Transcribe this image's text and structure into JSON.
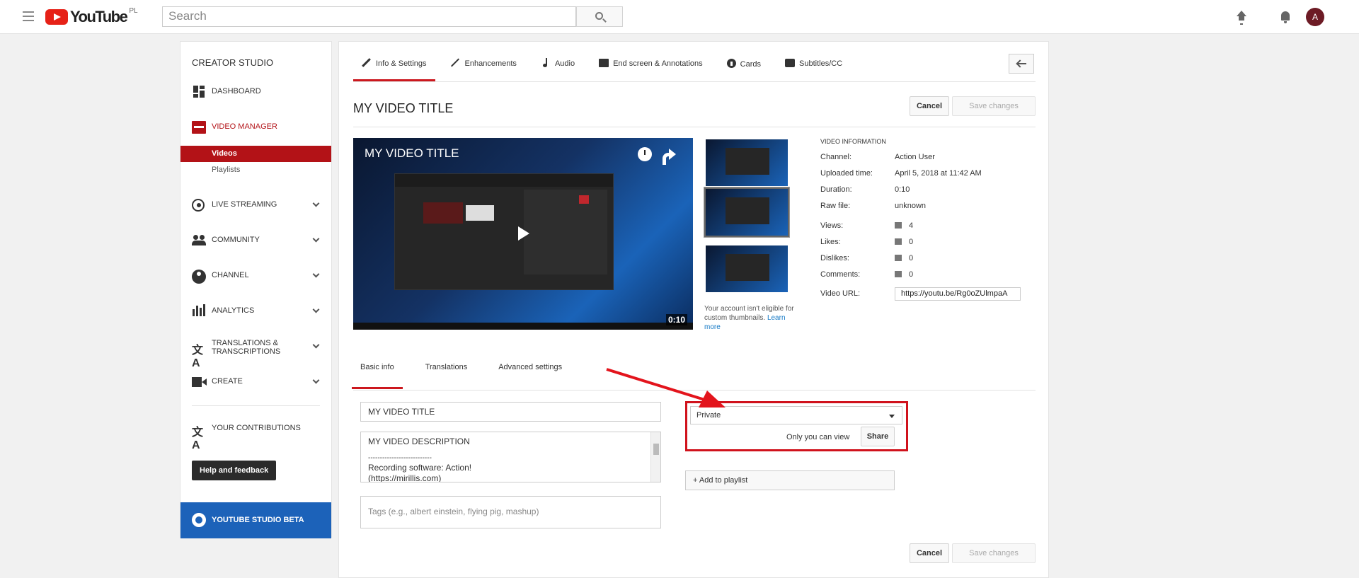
{
  "topbar": {
    "logo_text": "YouTube",
    "country": "PL",
    "search_placeholder": "Search",
    "avatar_initial": "A"
  },
  "sidebar": {
    "title": "CREATOR STUDIO",
    "items": [
      {
        "label": "DASHBOARD",
        "icon": "dashboard-icon"
      },
      {
        "label": "VIDEO MANAGER",
        "icon": "video-manager-icon",
        "active": true
      },
      {
        "label": "LIVE STREAMING",
        "icon": "live-streaming-icon"
      },
      {
        "label": "COMMUNITY",
        "icon": "community-icon"
      },
      {
        "label": "CHANNEL",
        "icon": "channel-icon"
      },
      {
        "label": "ANALYTICS",
        "icon": "analytics-icon"
      },
      {
        "label": "TRANSLATIONS & TRANSCRIPTIONS",
        "icon": "translations-icon"
      },
      {
        "label": "CREATE",
        "icon": "create-icon"
      }
    ],
    "subitems": [
      {
        "label": "Videos",
        "active": true
      },
      {
        "label": "Playlists"
      }
    ],
    "contributions_label": "YOUR CONTRIBUTIONS",
    "help_label": "Help and feedback",
    "beta_label": "YOUTUBE STUDIO BETA"
  },
  "tabs": [
    {
      "label": "Info & Settings",
      "icon": "pencil-icon",
      "active": true
    },
    {
      "label": "Enhancements",
      "icon": "magic-wand-icon"
    },
    {
      "label": "Audio",
      "icon": "music-note-icon"
    },
    {
      "label": "End screen & Annotations",
      "icon": "end-screen-icon"
    },
    {
      "label": "Cards",
      "icon": "info-circle-icon"
    },
    {
      "label": "Subtitles/CC",
      "icon": "cc-icon"
    }
  ],
  "video": {
    "title": "MY VIDEO TITLE",
    "duration": "0:10"
  },
  "buttons": {
    "cancel": "Cancel",
    "save": "Save changes",
    "share": "Share",
    "add_playlist": "+ Add to playlist"
  },
  "thumb_note": {
    "text": "Your account isn't eligible for custom thumbnails.",
    "link": "Learn more"
  },
  "video_info": {
    "heading": "VIDEO INFORMATION",
    "channel_label": "Channel:",
    "channel": "Action User",
    "uploaded_label": "Uploaded time:",
    "uploaded": "April 5, 2018 at 11:42 AM",
    "duration_label": "Duration:",
    "duration": "0:10",
    "raw_label": "Raw file:",
    "raw": "unknown",
    "views_label": "Views:",
    "views": "4",
    "likes_label": "Likes:",
    "likes": "0",
    "dislikes_label": "Dislikes:",
    "dislikes": "0",
    "comments_label": "Comments:",
    "comments": "0",
    "url_label": "Video URL:",
    "url": "https://youtu.be/Rg0oZUlmpaA"
  },
  "subtabs": [
    {
      "label": "Basic info",
      "active": true
    },
    {
      "label": "Translations"
    },
    {
      "label": "Advanced settings"
    }
  ],
  "form": {
    "title_value": "MY VIDEO TITLE",
    "desc_line1": "MY VIDEO DESCRIPTION",
    "desc_line2": "---------------------------",
    "desc_line3": "Recording software: Action!",
    "desc_line4": "(https://mirillis.com)",
    "tags_placeholder": "Tags (e.g., albert einstein, flying pig, mashup)",
    "privacy": "Private",
    "privacy_note": "Only you can view"
  },
  "colors": {
    "accent": "#cc181e",
    "beta_blue": "#1c62b9",
    "highlight": "#d0121c"
  }
}
